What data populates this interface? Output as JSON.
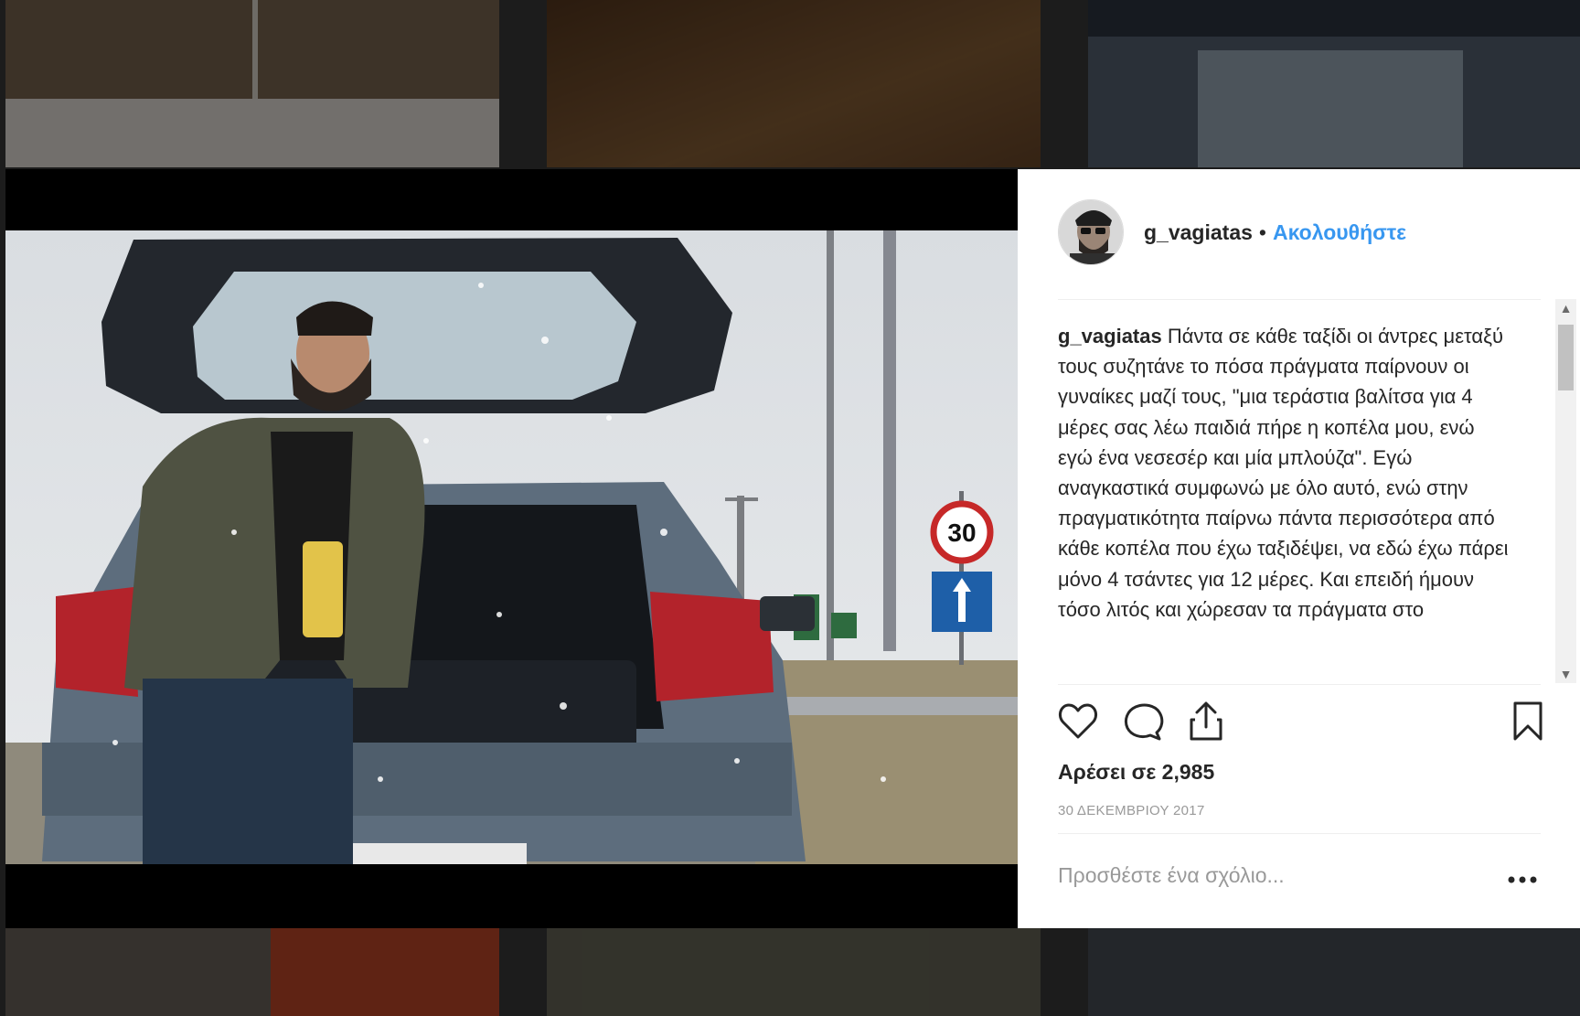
{
  "post": {
    "username": "g_vagiatas",
    "separator": "•",
    "follow_label": "Ακολουθήστε",
    "caption_username": "g_vagiatas",
    "caption_text": " Πάντα σε κάθε ταξίδι οι άντρες μεταξύ τους συζητάνε το πόσα πράγματα παίρνουν οι γυναίκες μαζί τους, \"μια τεράστια βαλίτσα για 4 μέρες σας λέω παιδιά πήρε η κοπέλα μου, ενώ εγώ ένα νεσεσέρ και μία μπλούζα\". Εγώ αναγκαστικά συμφωνώ με όλο αυτό, ενώ στην πραγματικότητα παίρνω πάντα περισσότερα από κάθε κοπέλα που έχω ταξιδέψει, να εδώ έχω πάρει μόνο 4 τσάντες για 12 μέρες. Και επειδή ήμουν τόσο λιτός και χώρεσαν τα πράγματα στο",
    "likes": "Αρέσει σε 2,985",
    "date": "30 ΔΕΚΕΜΒΡΙΟΥ 2017",
    "comment_placeholder": "Προσθέστε ένα σχόλιο...",
    "speed_sign": "30"
  },
  "icons": {
    "like": "heart-icon",
    "comment": "comment-bubble-icon",
    "share": "share-upload-icon",
    "save": "bookmark-icon",
    "more": "more-options-icon"
  },
  "colors": {
    "link": "#3897f0",
    "text": "#262626",
    "muted": "#999999"
  }
}
